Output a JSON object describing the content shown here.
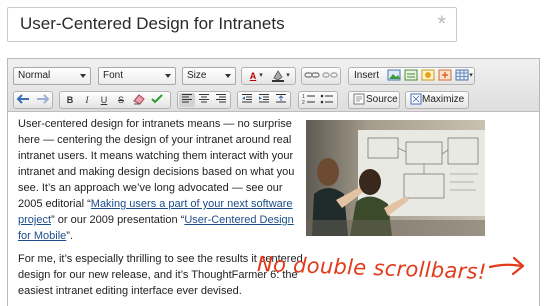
{
  "title_field": {
    "value": "User-Centered Design for Intranets",
    "required_marker": "*"
  },
  "toolbar": {
    "format_select": "Normal",
    "font_select": "Font",
    "size_select": "Size",
    "text_color_label": "A",
    "bold_label": "B",
    "italic_label": "I",
    "underline_label": "U",
    "strike_label": "S",
    "insert_label": "Insert",
    "source_label": "Source",
    "maximize_label": "Maximize"
  },
  "content": {
    "p1_part1": "User-centered design for intranets means — no surprise here — centering the design of your intranet around real intranet users. It means watching them interact with your intranet and making design decisions based on what you see. It’s an approach we’ve long advocated — see our 2005 editorial “",
    "link1": "Making users a part of your next software project",
    "p1_part2": "” or our 2009 presentation “",
    "link2": "User-Centered Design for Mobile",
    "p1_part3": "”.",
    "p2": "For me, it’s especially thrilling to see the results it centered design for our new release, and it’s ThoughtFarmer 6: the easiest intranet editing interface ever devised."
  },
  "annotation": {
    "text": "No double scrollbars!"
  },
  "colors": {
    "annotation": "#e23a1a",
    "link": "#1b4d8c"
  }
}
